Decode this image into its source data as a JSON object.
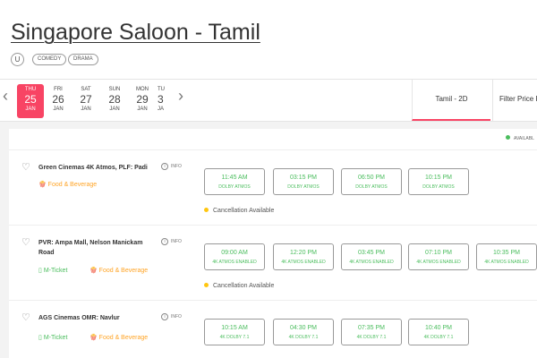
{
  "movie": {
    "title": "Singapore Saloon - Tamil",
    "certificate": "U",
    "genres": [
      "COMEDY",
      "DRAMA"
    ]
  },
  "dates": [
    {
      "day": "THU",
      "num": "25",
      "month": "JAN",
      "selected": true
    },
    {
      "day": "FRI",
      "num": "26",
      "month": "JAN"
    },
    {
      "day": "SAT",
      "num": "27",
      "month": "JAN"
    },
    {
      "day": "SUN",
      "num": "28",
      "month": "JAN"
    },
    {
      "day": "MON",
      "num": "29",
      "month": "JAN"
    },
    {
      "day": "TU",
      "num": "3",
      "month": "JA"
    }
  ],
  "nav": {
    "prev": "‹",
    "next": "›"
  },
  "format_tab": "Tamil - 2D",
  "filter_label": "Filter Price Ra",
  "legend_available": "AVAILABL",
  "colors": {
    "accent": "#f84464",
    "available": "#4abd5d",
    "food": "#ffa426",
    "cancel_dot": "#ffc610"
  },
  "icons": {
    "heart": "heart-icon",
    "info": "info-icon",
    "mticket": "mobile-icon",
    "food": "food-icon"
  },
  "cinemas": [
    {
      "name": "Green Cinemas 4K Atmos, PLF: Padi",
      "info": "INFO",
      "amenities": [
        {
          "type": "food",
          "label": "Food & Beverage"
        }
      ],
      "showtimes": [
        {
          "time": "11:45 AM",
          "format": "DOLBY ATMOS"
        },
        {
          "time": "03:15 PM",
          "format": "DOLBY ATMOS"
        },
        {
          "time": "06:50 PM",
          "format": "DOLBY ATMOS"
        },
        {
          "time": "10:15 PM",
          "format": "DOLBY ATMOS"
        }
      ],
      "cancellation": "Cancellation Available"
    },
    {
      "name": "PVR: Ampa Mall, Nelson Manickam Road",
      "info": "INFO",
      "amenities": [
        {
          "type": "mticket",
          "label": "M-Ticket"
        },
        {
          "type": "food",
          "label": "Food & Beverage"
        }
      ],
      "showtimes": [
        {
          "time": "09:00 AM",
          "format": "4K ATMOS ENABLED"
        },
        {
          "time": "12:20 PM",
          "format": "4K ATMOS ENABLED"
        },
        {
          "time": "03:45 PM",
          "format": "4K ATMOS ENABLED"
        },
        {
          "time": "07:10 PM",
          "format": "4K ATMOS ENABLED"
        },
        {
          "time": "10:35 PM",
          "format": "4K ATMOS ENABLED"
        }
      ],
      "cancellation": "Cancellation Available"
    },
    {
      "name": "AGS Cinemas OMR: Navlur",
      "info": "INFO",
      "amenities": [
        {
          "type": "mticket",
          "label": "M-Ticket"
        },
        {
          "type": "food",
          "label": "Food & Beverage"
        }
      ],
      "showtimes": [
        {
          "time": "10:15 AM",
          "format": "4K DOLBY 7.1"
        },
        {
          "time": "04:30 PM",
          "format": "4K DOLBY 7.1"
        },
        {
          "time": "07:35 PM",
          "format": "4K DOLBY 7.1"
        },
        {
          "time": "10:40 PM",
          "format": "4K DOLBY 7.1"
        }
      ]
    }
  ]
}
